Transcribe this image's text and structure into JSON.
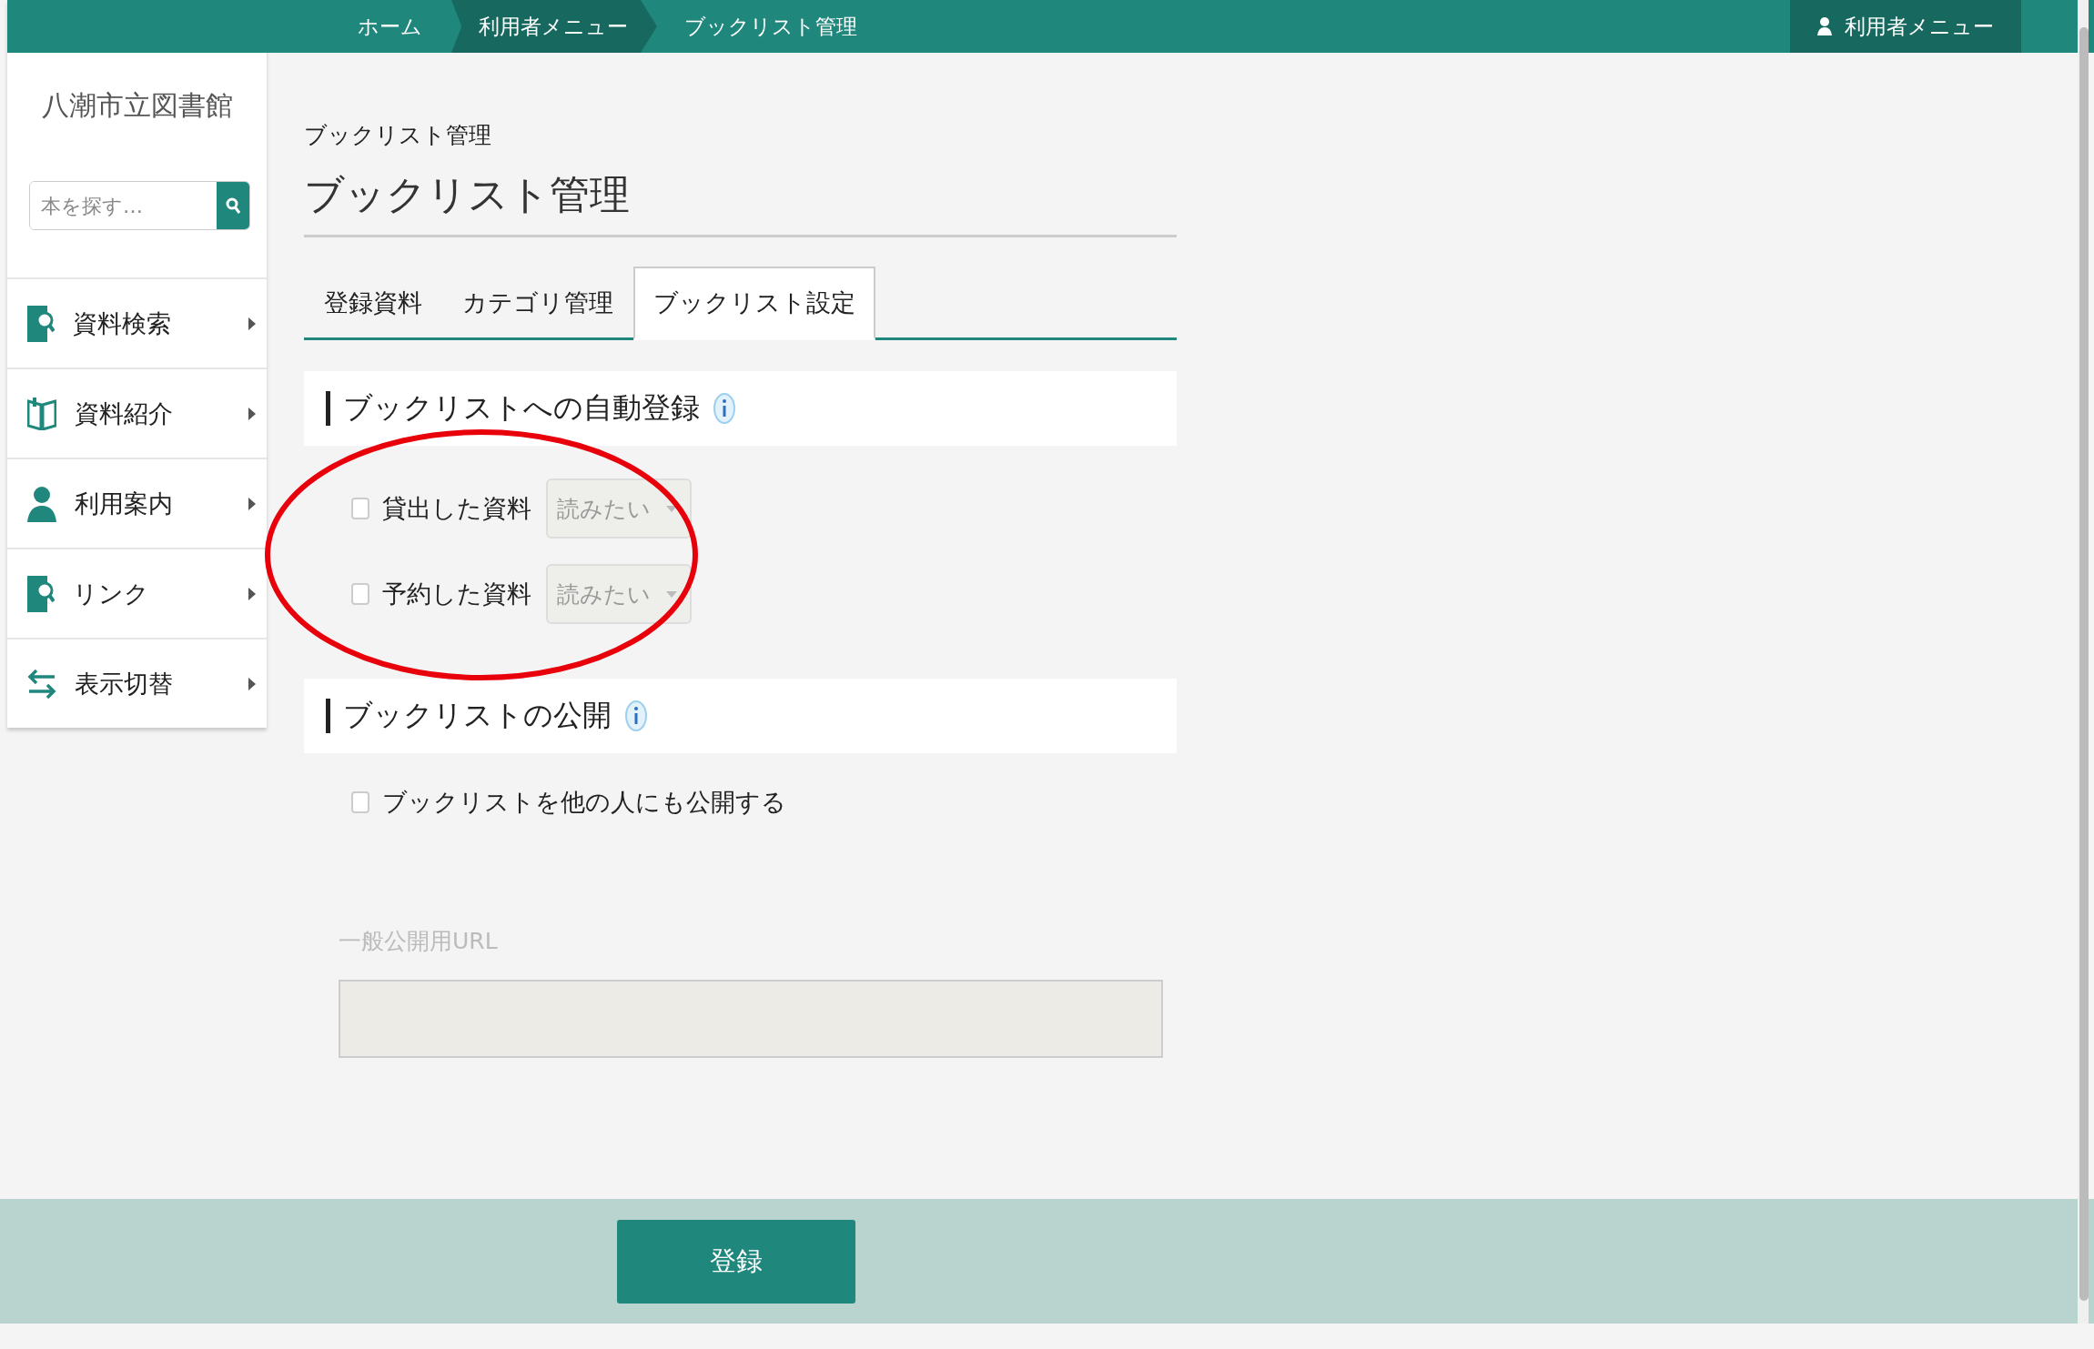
{
  "header": {
    "breadcrumbs": [
      {
        "label": "ホーム",
        "highlighted": false
      },
      {
        "label": "利用者メニュー",
        "highlighted": true
      },
      {
        "label": "ブックリスト管理",
        "highlighted": false
      }
    ],
    "user_menu": "利用者メニュー"
  },
  "sidebar": {
    "library_name": "八潮市立図書館",
    "search": {
      "placeholder": "本を探す…"
    },
    "items": [
      {
        "label": "資料検索",
        "kind": "search"
      },
      {
        "label": "資料紹介",
        "kind": "book"
      },
      {
        "label": "利用案内",
        "kind": "person"
      },
      {
        "label": "リンク",
        "kind": "search"
      },
      {
        "label": "表示切替",
        "kind": "swap"
      }
    ]
  },
  "page": {
    "breadcrumb_title": "ブックリスト管理",
    "title": "ブックリスト管理",
    "tabs": [
      {
        "label": "登録資料",
        "selected": false
      },
      {
        "label": "カテゴリ管理",
        "selected": false
      },
      {
        "label": "ブックリスト設定",
        "selected": true
      }
    ],
    "sections": [
      {
        "title": "ブックリストへの自動登録",
        "info": true,
        "annotated": true,
        "rows": [
          {
            "kind": "select",
            "label": "貸出した資料",
            "checked": false,
            "value": "読みたい"
          },
          {
            "kind": "select",
            "label": "予約した資料",
            "checked": false,
            "value": "読みたい"
          }
        ]
      },
      {
        "title": "ブックリストの公開",
        "info": true,
        "rows": [
          {
            "kind": "checkbox",
            "label": "ブックリストを他の人にも公開する",
            "checked": false
          },
          {
            "kind": "url",
            "label": "一般公開用URL",
            "disabled": true
          }
        ]
      }
    ]
  },
  "footer": {
    "submit": "登録"
  }
}
